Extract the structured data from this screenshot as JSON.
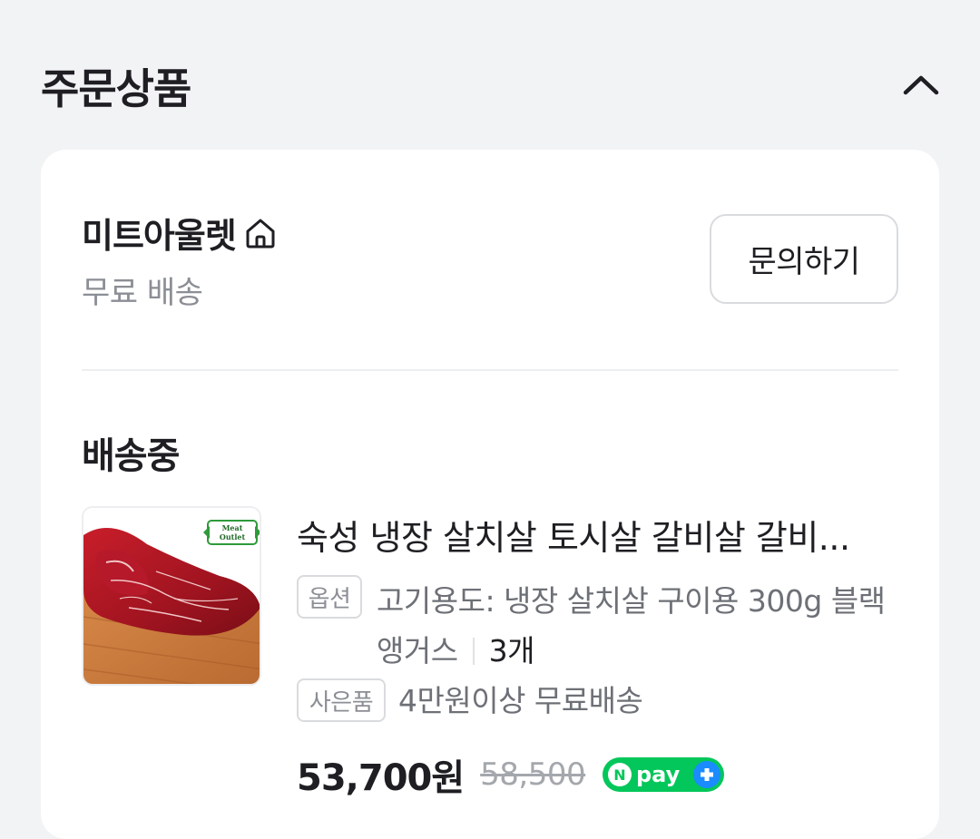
{
  "section": {
    "title": "주문상품"
  },
  "seller": {
    "name": "미트아울렛",
    "shipping_fee": "무료 배송",
    "inquiry_label": "문의하기"
  },
  "order": {
    "status": "배송중",
    "product": {
      "name": "숙성 냉장 살치살 토시살 갈비살 갈비...",
      "thumb_logo_line1": "Meat",
      "thumb_logo_line2": "Outlet",
      "option_label": "옵션",
      "option_value": "고기용도: 냉장 살치살 구이용 300g 블랙앵거스",
      "quantity": "3개",
      "gift_label": "사은품",
      "gift_value": "4만원이상 무료배송",
      "price": "53,700원",
      "original_price": "58,500",
      "payment_badge": "pay"
    }
  },
  "colors": {
    "background": "#f2f3f5",
    "card": "#ffffff",
    "npay_green": "#03c75a",
    "npay_blue": "#1a8cff"
  },
  "icons": {
    "collapse": "chevron-up-icon",
    "store": "home-icon"
  }
}
